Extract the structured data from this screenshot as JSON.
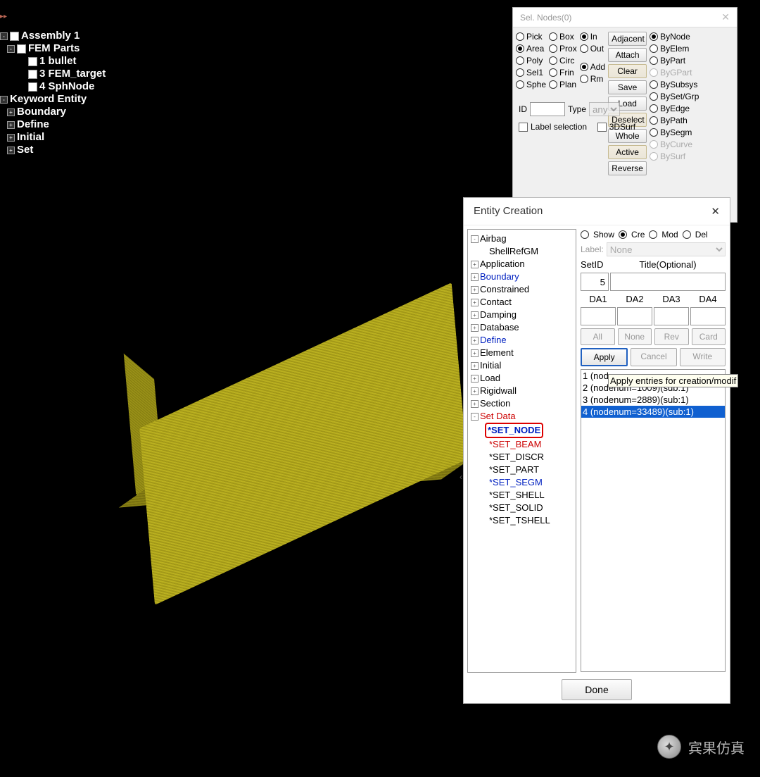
{
  "tree": {
    "root": "Assembly 1",
    "fem_parts": "FEM Parts",
    "items": [
      "1 bullet",
      "3 FEM_target",
      "4 SphNode"
    ],
    "keyword": "Keyword Entity",
    "kw_items": [
      "Boundary",
      "Define",
      "Initial",
      "Set"
    ]
  },
  "sel": {
    "title": "Sel. Nodes(0)",
    "col1": [
      "Pick",
      "Area",
      "Poly",
      "Sel1",
      "Sphe"
    ],
    "col2": [
      "Box",
      "Prox",
      "Circ",
      "Frin",
      "Plan"
    ],
    "col3a": [
      "In",
      "Out"
    ],
    "col3b": [
      "Add",
      "Rm"
    ],
    "btns": [
      "Adjacent",
      "Attach",
      "Clear",
      "Save",
      "Load",
      "Deselect",
      "Whole",
      "Active",
      "Reverse"
    ],
    "col5": [
      "ByNode",
      "ByElem",
      "ByPart",
      "ByGPart",
      "BySubsys",
      "BySet/Grp",
      "ByEdge",
      "ByPath",
      "BySegm",
      "ByCurve",
      "BySurf"
    ],
    "id": "ID",
    "type": "Type",
    "type_val": "any",
    "label_sel": "Label selection",
    "surf3d": "3DSurf"
  },
  "ent": {
    "title": "Entity Creation",
    "tree": {
      "airbag": "Airbag",
      "shellref": "ShellRefGM",
      "items": [
        "Application",
        "Boundary",
        "Constrained",
        "Contact",
        "Damping",
        "Database",
        "Define",
        "Element",
        "Initial",
        "Load",
        "Rigidwall",
        "Section",
        "Set Data"
      ],
      "links": {
        "Boundary": true,
        "Define": true,
        "Set Data": true
      },
      "set_node": "*SET_NODE",
      "set_items": [
        "*SET_BEAM",
        "*SET_DISCR",
        "*SET_PART",
        "*SET_SEGM",
        "*SET_SHELL",
        "*SET_SOLID",
        "*SET_TSHELL"
      ],
      "set_links": {
        "*SET_SEGM": true
      }
    },
    "modes": [
      "Show",
      "Cre",
      "Mod",
      "Del"
    ],
    "label": "Label:",
    "label_val": "None",
    "setid": "SetID",
    "title_opt": "Title(Optional)",
    "setid_val": "5",
    "da": [
      "DA1",
      "DA2",
      "DA3",
      "DA4"
    ],
    "btns1": [
      "All",
      "None",
      "Rev",
      "Card"
    ],
    "apply": "Apply",
    "cancel": "Cancel",
    "write": "Write",
    "list": [
      "1 (nod",
      "2 (nodenum=1009)(sub:1)",
      "3 (nodenum=2889)(sub:1)",
      "4 (nodenum=33489)(sub:1)"
    ],
    "tooltip": "Apply entries for creation/modif",
    "done": "Done"
  },
  "watermark": "宾果仿真"
}
